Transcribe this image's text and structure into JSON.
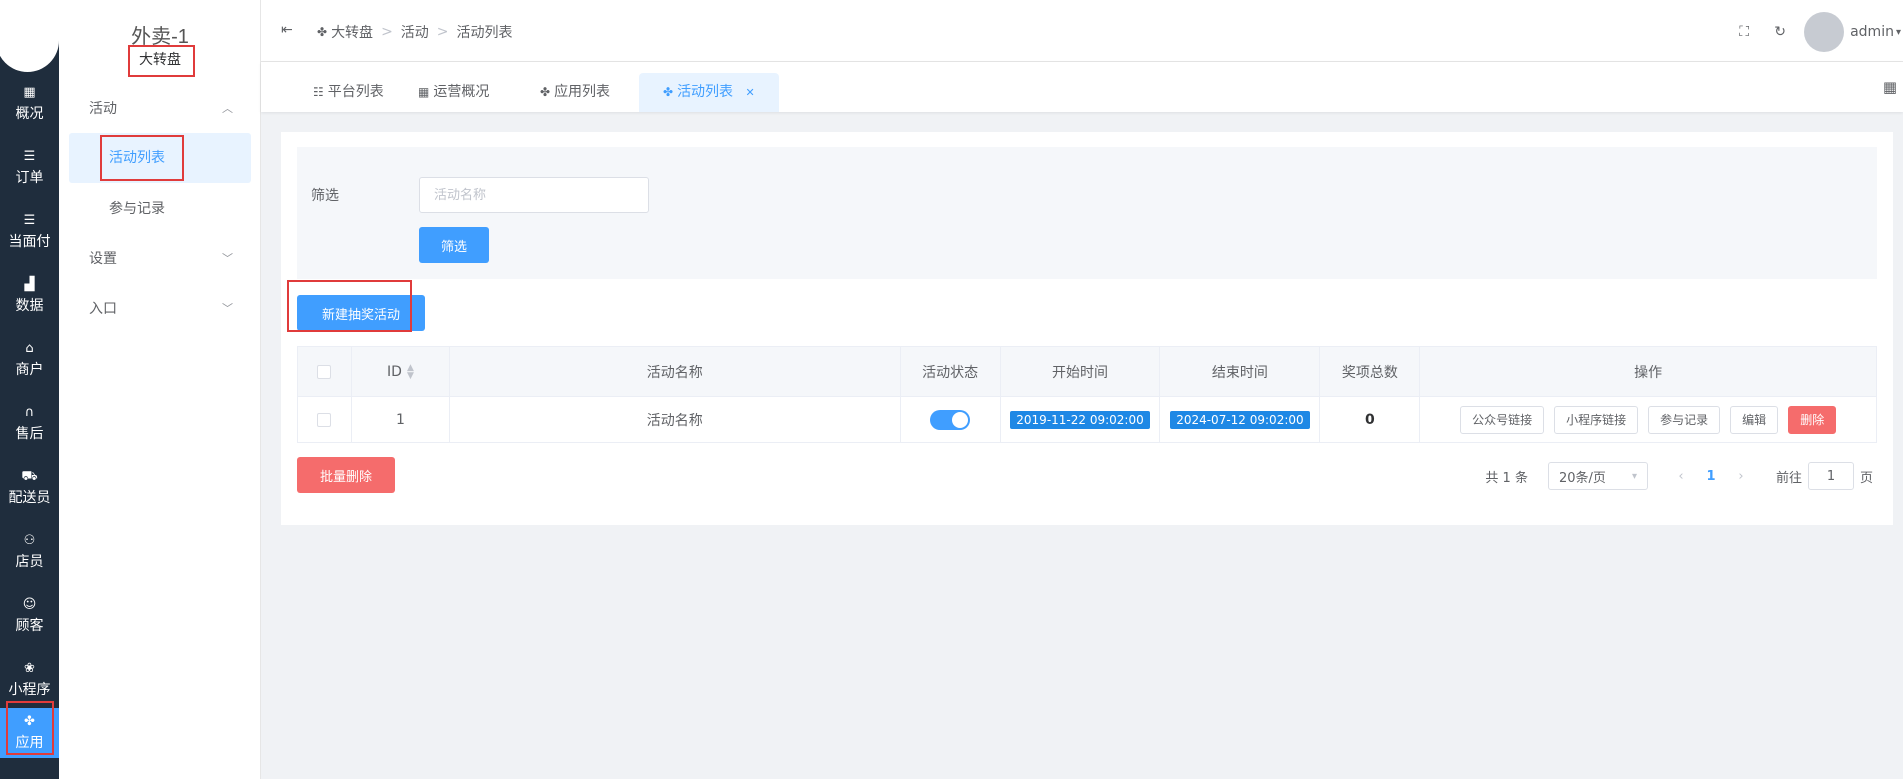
{
  "rail": {
    "items": [
      {
        "icon": "▦",
        "label": "概况"
      },
      {
        "icon": "☰",
        "label": "订单"
      },
      {
        "icon": "☰",
        "label": "当面付"
      },
      {
        "icon": "▟",
        "label": "数据"
      },
      {
        "icon": "⌂",
        "label": "商户"
      },
      {
        "icon": "∩",
        "label": "售后"
      },
      {
        "icon": "⛟",
        "label": "配送员"
      },
      {
        "icon": "⚇",
        "label": "店员"
      },
      {
        "icon": "☺",
        "label": "顾客"
      },
      {
        "icon": "❀",
        "label": "小程序"
      },
      {
        "icon": "✤",
        "label": "应用"
      }
    ]
  },
  "submenu": {
    "store_title": "外卖-1",
    "app_name": "大转盘",
    "groups": [
      {
        "label": "活动",
        "caret": "︿"
      },
      {
        "label": "设置",
        "caret": "﹀"
      },
      {
        "label": "入口",
        "caret": "﹀"
      }
    ],
    "children": [
      {
        "label": "活动列表"
      },
      {
        "label": "参与记录"
      }
    ]
  },
  "header": {
    "fold_icon": "⇤",
    "breadcrumb": [
      {
        "label": "大转盘"
      },
      {
        "label": "活动"
      },
      {
        "label": "活动列表"
      }
    ],
    "separator": ">",
    "user": "admin"
  },
  "tabs": [
    {
      "label": "平台列表"
    },
    {
      "label": "运营概况"
    },
    {
      "label": "应用列表"
    },
    {
      "label": "活动列表"
    }
  ],
  "filter": {
    "label": "筛选",
    "placeholder": "活动名称",
    "button": "筛选"
  },
  "actions": {
    "create": "新建抽奖活动",
    "batch_delete": "批量删除"
  },
  "table": {
    "headers": [
      "ID",
      "活动名称",
      "活动状态",
      "开始时间",
      "结束时间",
      "奖项总数",
      "操作"
    ],
    "rows": [
      {
        "id": "1",
        "name": "活动名称",
        "status_on": true,
        "start": "2019-11-22 09:02:00",
        "end": "2024-07-12 09:02:00",
        "prize_total": "0",
        "ops": [
          "公众号链接",
          "小程序链接",
          "参与记录",
          "编辑",
          "删除"
        ]
      }
    ]
  },
  "pagination": {
    "total": "共 1 条",
    "page_size": "20条/页",
    "current": "1",
    "goto_label": "前往",
    "goto_value": "1",
    "page_suffix": "页"
  },
  "colors": {
    "primary": "#409eff",
    "danger": "#f56c6c",
    "rail_bg": "#1f2d3d",
    "highlight_box": "#e03b3b"
  }
}
